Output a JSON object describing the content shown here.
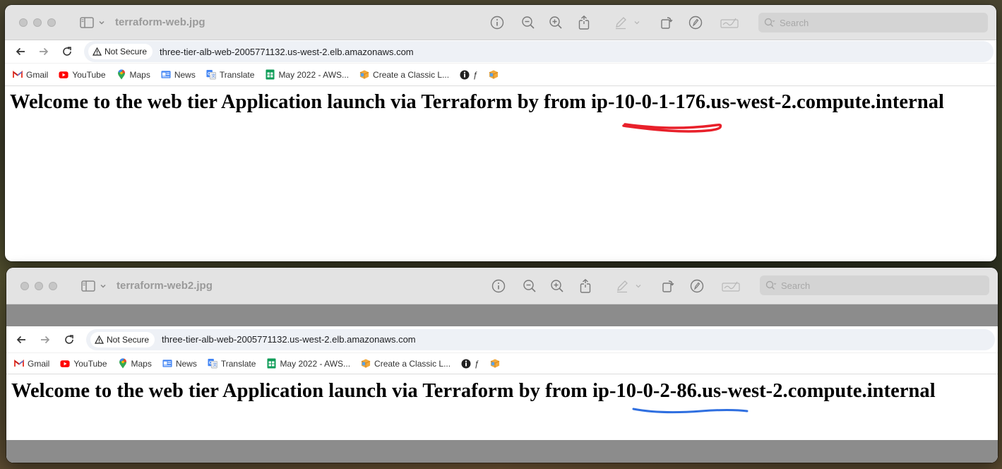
{
  "windows": [
    {
      "title": "terraform-web.jpg",
      "search_placeholder": "Search",
      "browser": {
        "security_label": "Not Secure",
        "url": "three-tier-alb-web-2005771132.us-west-2.elb.amazonaws.com",
        "bookmarks": [
          "Gmail",
          "YouTube",
          "Maps",
          "News",
          "Translate",
          "May 2022 - AWS...",
          "Create a Classic L...",
          "ƒ"
        ]
      },
      "page_heading": "Welcome to the web tier Application launch via Terraform by from ip-10-0-1-176.us-west-2.compute.internal",
      "annotation_color": "#e8202a"
    },
    {
      "title": "terraform-web2.jpg",
      "search_placeholder": "Search",
      "browser": {
        "security_label": "Not Secure",
        "url": "three-tier-alb-web-2005771132.us-west-2.elb.amazonaws.com",
        "bookmarks": [
          "Gmail",
          "YouTube",
          "Maps",
          "News",
          "Translate",
          "May 2022 - AWS...",
          "Create a Classic L...",
          "ƒ"
        ]
      },
      "page_heading": "Welcome to the web tier Application launch via Terraform by from ip-10-0-2-86.us-west-2.compute.internal",
      "annotation_color": "#2f6fe0"
    }
  ],
  "icons": {
    "toolbar": [
      "info-icon",
      "zoom-out-icon",
      "zoom-in-icon",
      "share-icon",
      "markup-pen-icon",
      "chevron-down-icon",
      "rotate-icon",
      "markup-circle-icon",
      "signature-icon"
    ],
    "bookmarks": [
      "gmail-icon",
      "youtube-icon",
      "maps-icon",
      "news-icon",
      "translate-icon",
      "sheets-icon",
      "aws-cube-icon",
      "aws-cube-icon",
      "info-dark-icon",
      "aws-cube-icon"
    ]
  }
}
